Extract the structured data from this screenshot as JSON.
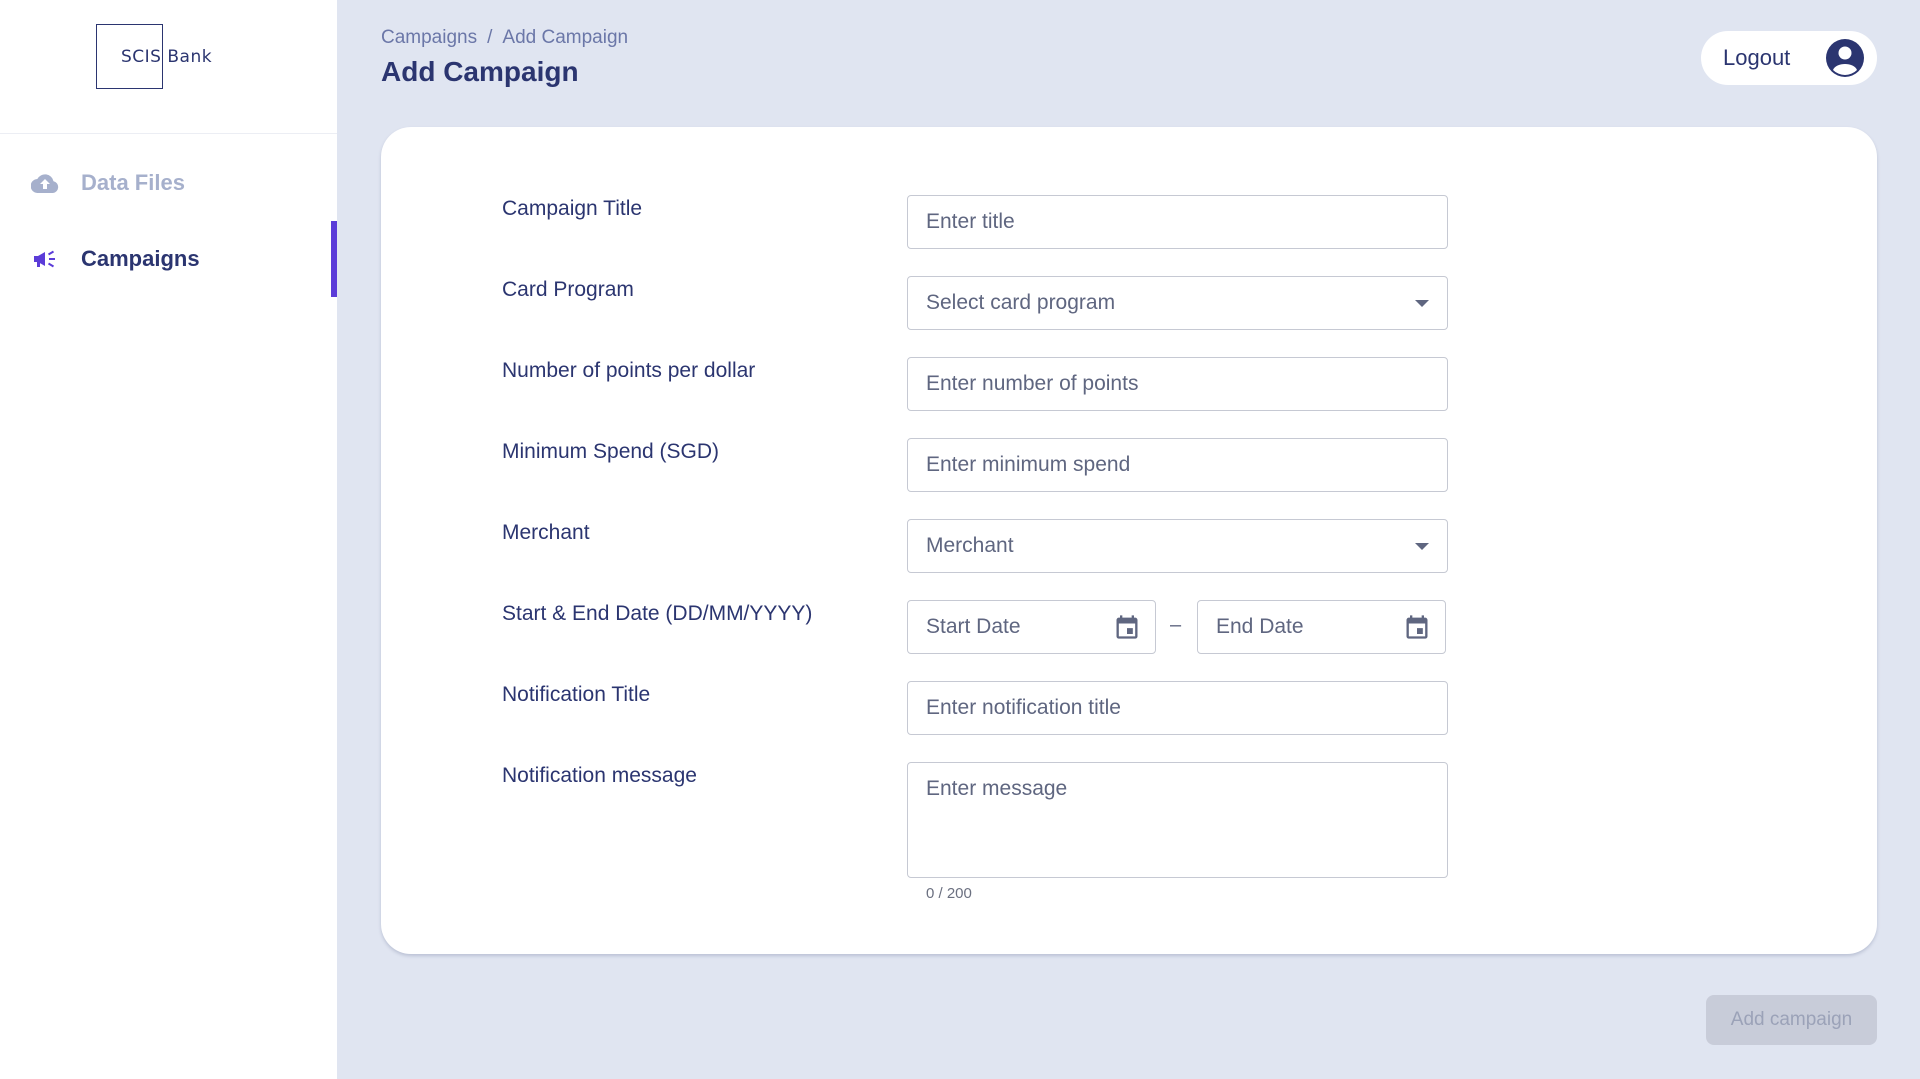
{
  "sidebar": {
    "logo_text": "SCIS Bank",
    "items": [
      {
        "label": "Data Files",
        "icon": "cloud-upload-icon"
      },
      {
        "label": "Campaigns",
        "icon": "megaphone-icon",
        "active": true
      }
    ]
  },
  "header": {
    "breadcrumb": [
      "Campaigns",
      "Add Campaign"
    ],
    "breadcrumb_sep": "/",
    "title": "Add Campaign",
    "logout_label": "Logout"
  },
  "form": {
    "campaign_title": {
      "label": "Campaign Title",
      "placeholder": "Enter title"
    },
    "card_program": {
      "label": "Card Program",
      "placeholder": "Select card program"
    },
    "points": {
      "label": "Number of points per dollar",
      "placeholder": "Enter number of points"
    },
    "min_spend": {
      "label": "Minimum Spend (SGD)",
      "placeholder": "Enter minimum spend"
    },
    "merchant": {
      "label": "Merchant",
      "placeholder": "Merchant"
    },
    "dates": {
      "label": "Start & End Date (DD/MM/YYYY)",
      "start_placeholder": "Start Date",
      "end_placeholder": "End Date",
      "separator": "–"
    },
    "notification_title": {
      "label": "Notification Title",
      "placeholder": "Enter notification title"
    },
    "notification_message": {
      "label": "Notification message",
      "placeholder": "Enter message",
      "counter": "0 / 200"
    }
  },
  "actions": {
    "add_campaign_label": "Add campaign"
  },
  "colors": {
    "accent": "#5b3cd8",
    "primary_text": "#2b3570",
    "background": "#e0e5f1"
  }
}
